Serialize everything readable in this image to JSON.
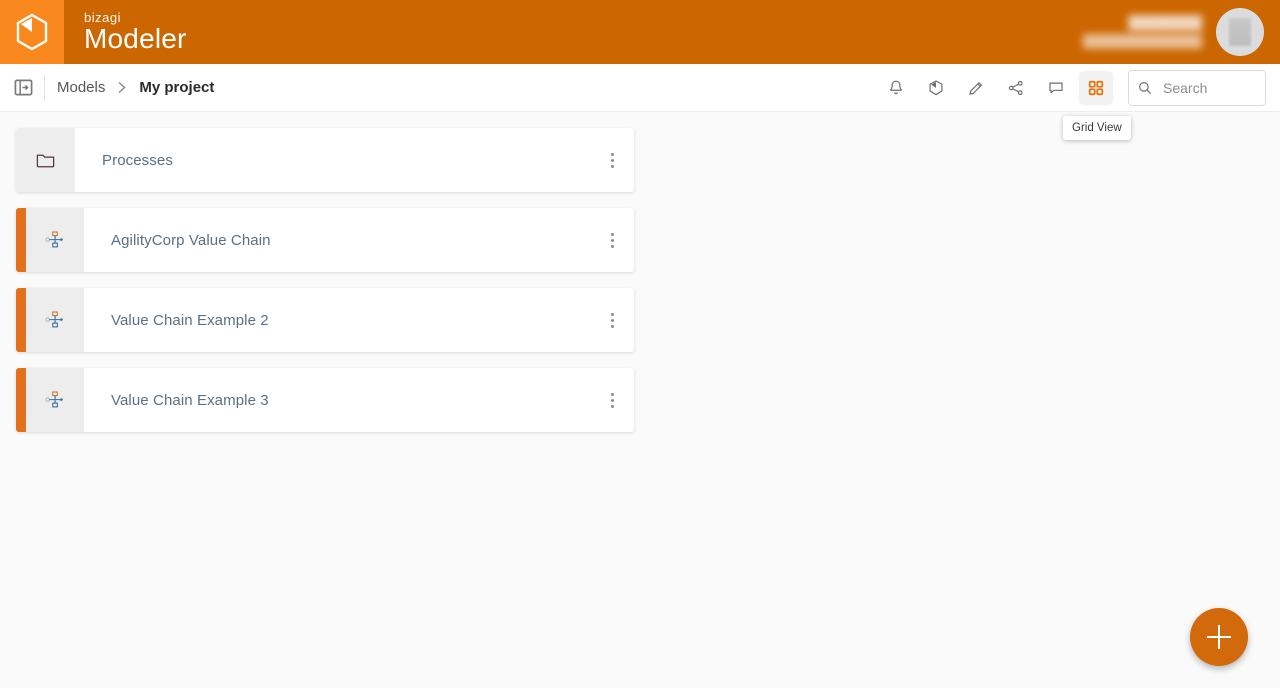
{
  "header": {
    "logo_icon": "cube-hexagon-icon",
    "brand_small": "bizagi",
    "brand_main": "Modeler",
    "user_name": "████████",
    "user_mail": "██████████████",
    "avatar_alt": "user-avatar"
  },
  "toolbar": {
    "panel_toggle_icon": "panel-toggle-icon",
    "breadcrumb": {
      "root": "Models",
      "separator": "›",
      "current": "My project"
    },
    "actions": [
      {
        "name": "notifications-bell-icon",
        "label": "Notifications"
      },
      {
        "name": "cube-shield-icon",
        "label": "Model"
      },
      {
        "name": "pencil-edit-icon",
        "label": "Edit"
      },
      {
        "name": "share-nodes-icon",
        "label": "Share"
      },
      {
        "name": "comment-bubble-icon",
        "label": "Comments"
      },
      {
        "name": "grid-view-icon",
        "label": "Grid View"
      }
    ],
    "active_action": "grid-view-icon",
    "tooltip": "Grid View",
    "search": {
      "placeholder": "Search",
      "value": "",
      "icon": "search-icon"
    }
  },
  "content": {
    "items": [
      {
        "title": "Processes",
        "type": "folder",
        "icon": "folder-icon",
        "accent": false
      },
      {
        "title": "AgilityCorp Value Chain",
        "type": "diagram",
        "icon": "hierarchy-icon",
        "accent": true
      },
      {
        "title": "Value Chain Example 2",
        "type": "diagram",
        "icon": "hierarchy-icon",
        "accent": true
      },
      {
        "title": "Value Chain Example 3",
        "type": "diagram",
        "icon": "hierarchy-icon",
        "accent": true
      }
    ],
    "menu_icon": "kebab-menu-icon",
    "fab": {
      "icon": "plus-icon",
      "label": "New"
    }
  },
  "colors": {
    "brand_orange": "#cc6600",
    "logo_orange": "#f9881e",
    "accent_bar": "#e2701d",
    "fab": "#d2690a",
    "page_bg": "#fafafa",
    "card_bg": "#ffffff",
    "icon_box": "#ededed",
    "title_text": "#5c7080"
  }
}
